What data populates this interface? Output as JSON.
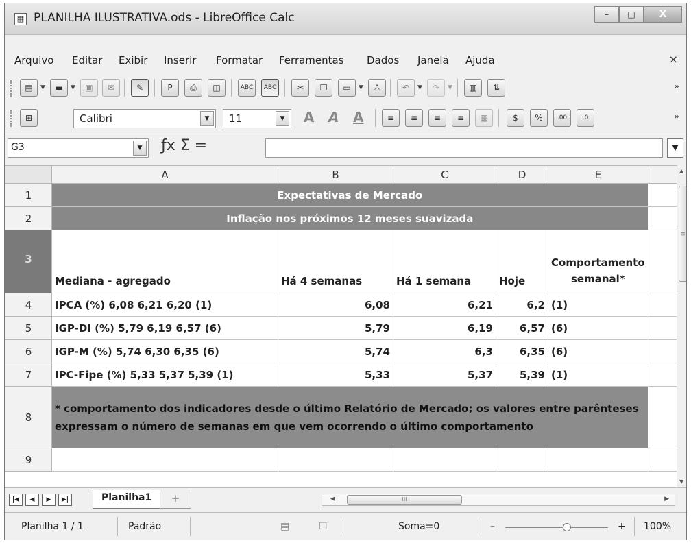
{
  "window": {
    "title": "PLANILHA ILUSTRATIVA.ods - LibreOffice Calc",
    "btn_min": "–",
    "btn_max": "□",
    "btn_close": "X"
  },
  "menu": {
    "items": [
      "Arquivo",
      "Editar",
      "Exibir",
      "Inserir",
      "Formatar",
      "Ferramentas",
      "Dados",
      "Janela",
      "Ajuda"
    ],
    "close": "×"
  },
  "toolbar": {
    "font_name": "Calibri",
    "font_size": "11",
    "more": "»"
  },
  "formula_bar": {
    "name_box": "G3",
    "icons": "ƒx Σ =",
    "content": ""
  },
  "grid": {
    "columns": [
      "A",
      "B",
      "C",
      "D",
      "E"
    ],
    "rows": [
      "1",
      "2",
      "3",
      "4",
      "5",
      "6",
      "7",
      "8",
      "9"
    ],
    "row1": "Expectativas de Mercado",
    "row2": "Inflação nos próximos 12 meses suavizada",
    "header": {
      "a": "Mediana - agregado",
      "b": "Há 4 semanas",
      "c": "Há 1 semana",
      "d": "Hoje",
      "e": "Comportamento semanal*"
    },
    "data": [
      {
        "a": "IPCA (%) 6,08 6,21 6,20 (1)",
        "b": "6,08",
        "c": "6,21",
        "d": "6,2",
        "e": "(1)"
      },
      {
        "a": "IGP-DI (%) 5,79 6,19 6,57 (6)",
        "b": "5,79",
        "c": "6,19",
        "d": "6,57",
        "e": "(6)"
      },
      {
        "a": "IGP-M (%) 5,74 6,30 6,35 (6)",
        "b": "5,74",
        "c": "6,3",
        "d": "6,35",
        "e": "(6)"
      },
      {
        "a": "IPC-Fipe (%) 5,33 5,37 5,39 (1)",
        "b": "5,33",
        "c": "5,37",
        "d": "5,39",
        "e": "(1)"
      }
    ],
    "note": "* comportamento dos indicadores desde o último Relatório de Mercado; os valores entre parênteses expressam o número de semanas em que vem ocorrendo o último comportamento"
  },
  "tabs": {
    "sheet": "Planilha1",
    "add": "+"
  },
  "status": {
    "sheet_info": "Planilha 1 / 1",
    "style": "Padrão",
    "sum": "Soma=0",
    "zoom_minus": "–",
    "zoom_plus": "+",
    "zoom": "100%"
  },
  "colors": {
    "header_gray": "#888888",
    "selected_row": "#7a7a7a"
  },
  "icons": [
    "document-icon",
    "folder-icon",
    "save-icon",
    "email-icon",
    "edit-icon",
    "pdf-icon",
    "print-icon",
    "preview-icon",
    "spellcheck-icon",
    "autospell-icon",
    "cut-icon",
    "copy-icon",
    "paste-icon",
    "clone-format-icon",
    "undo-icon",
    "redo-icon",
    "chart-icon",
    "sort-icon",
    "borders-icon",
    "bold-icon",
    "italic-icon",
    "underline-icon",
    "align-left-icon",
    "align-center-icon",
    "align-right-icon",
    "justify-icon",
    "merge-icon",
    "currency-icon",
    "percent-icon",
    "add-decimal-icon",
    "remove-decimal-icon"
  ]
}
